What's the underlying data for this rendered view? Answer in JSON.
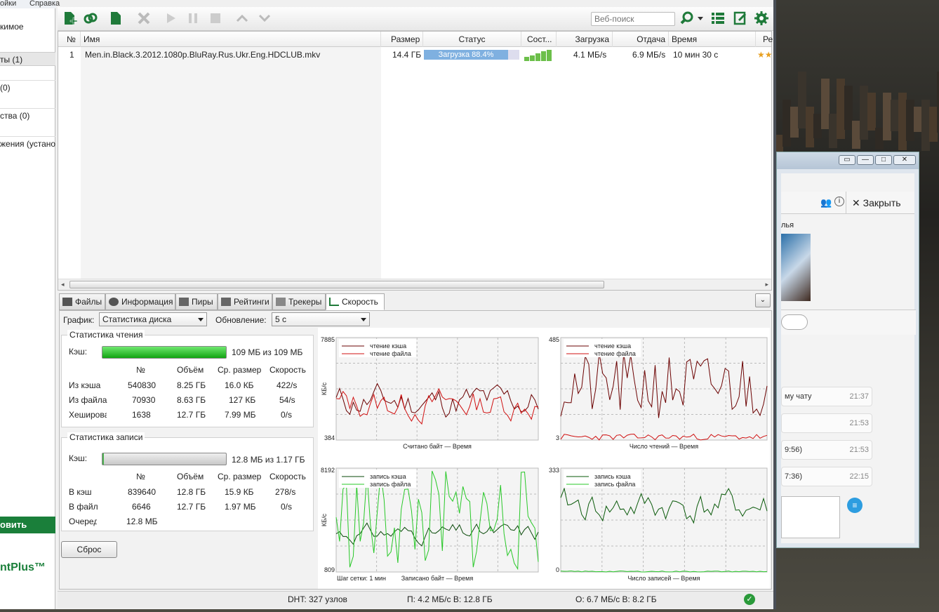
{
  "menu": {
    "item1": "ойки",
    "item2": "Справка"
  },
  "sidebar": {
    "items": [
      {
        "label": "кимое"
      },
      {
        "label": "ты (1)"
      },
      {
        "label": "(0)"
      },
      {
        "label": "ства (0)"
      },
      {
        "label": "жения (устано"
      }
    ],
    "cta": "овить",
    "logo": "ntPlus™"
  },
  "toolbar": {
    "search_placeholder": "Веб-поиск"
  },
  "list": {
    "columns": [
      "№",
      "Имя",
      "Размер",
      "Статус",
      "Сост...",
      "Загрузка",
      "Отдача",
      "Время",
      "Рей"
    ],
    "rows": [
      {
        "num": "1",
        "name": "Men.in.Black.3.2012.1080p.BluRay.Rus.Ukr.Eng.HDCLUB.mkv",
        "size": "14.4 ГБ",
        "status": "Загрузка 88.4%",
        "progress": 0.884,
        "down": "4.1 МБ/s",
        "up": "6.9 МБ/s",
        "time": "10 мин 30 с"
      }
    ]
  },
  "tabs": [
    {
      "label": "Файлы"
    },
    {
      "label": "Информация"
    },
    {
      "label": "Пиры"
    },
    {
      "label": "Рейтинги"
    },
    {
      "label": "Трекеры"
    },
    {
      "label": "Скорость"
    }
  ],
  "panel": {
    "graph_label": "График:",
    "graph_value": "Статистика диска",
    "update_label": "Обновление:",
    "update_value": "5 с",
    "read": {
      "title": "Статистика чтения",
      "cache_label": "Кэш:",
      "cache_text": "109 МБ из 109 МБ",
      "cache_fill": 1.0,
      "cols": [
        "№",
        "Объём",
        "Ср. размер",
        "Скорость"
      ],
      "rows": [
        [
          "Из кэша",
          "540830",
          "8.25 ГБ",
          "16.0 КБ",
          "422/s"
        ],
        [
          "Из файла",
          "70930",
          "8.63 ГБ",
          "127 КБ",
          "54/s"
        ],
        [
          "Хеширование",
          "1638",
          "12.7 ГБ",
          "7.99 МБ",
          "0/s"
        ]
      ]
    },
    "write": {
      "title": "Статистика записи",
      "cache_label": "Кэш:",
      "cache_text": "12.8 МБ из 1.17 ГБ",
      "cache_fill": 0.011,
      "cols": [
        "№",
        "Объём",
        "Ср. размер",
        "Скорость"
      ],
      "rows": [
        [
          "В кэш",
          "839640",
          "12.8 ГБ",
          "15.9 КБ",
          "278/s"
        ],
        [
          "В файл",
          "6646",
          "12.7 ГБ",
          "1.97 МБ",
          "0/s"
        ],
        [
          "Очередь",
          "12.8 МБ",
          "",
          "",
          ""
        ]
      ]
    },
    "reset": "Сброс"
  },
  "charts": {
    "c1": {
      "ymax": "7885",
      "ymin": "384",
      "ylabel": "КБ/с",
      "xlabel": "Считано байт — Время",
      "legend": [
        "чтение кэша",
        "чтение файла"
      ]
    },
    "c2": {
      "ymax": "485",
      "ymin": "3",
      "xlabel": "Число чтений — Время",
      "legend": [
        "чтение кэша",
        "чтение файла"
      ]
    },
    "c3": {
      "ymax": "8192",
      "ymin": "809",
      "ylabel": "КБ/с",
      "xlabel": "Записано байт — Время",
      "grid": "Шаг сетки: 1 мин",
      "legend": [
        "запись кэша",
        "запись файла"
      ]
    },
    "c4": {
      "ymax": "333",
      "ymin": "0",
      "xlabel": "Число записей — Время",
      "legend": [
        "запись кэша",
        "запись файла"
      ]
    }
  },
  "status": {
    "dht": "DHT: 327 узлов",
    "down": "П: 4.2 МБ/с В: 12.8 ГБ",
    "up": "О: 6.7 МБ/с В: 8.2 ГБ"
  },
  "chat": {
    "close": "Закрыть",
    "name": "лья",
    "items": [
      {
        "text": "му чату",
        "time": "21:37"
      },
      {
        "text": "",
        "time": "21:53"
      },
      {
        "text": "9:56)",
        "time": "21:53"
      },
      {
        "text": "7:36)",
        "time": "22:15"
      }
    ]
  }
}
